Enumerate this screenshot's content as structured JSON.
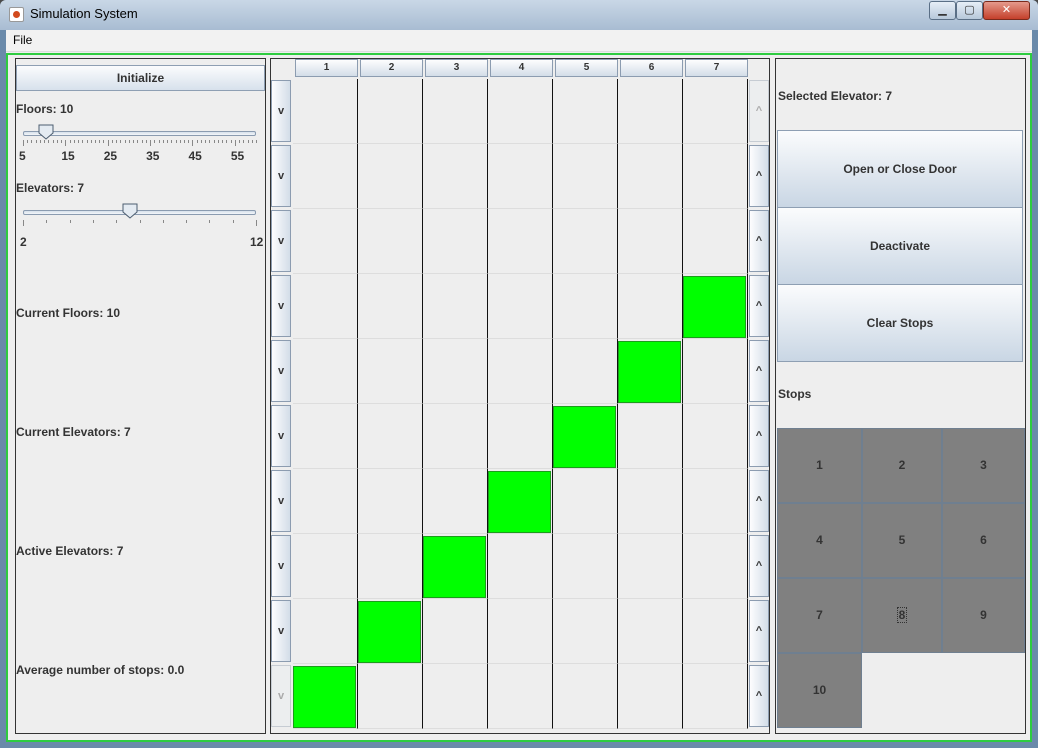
{
  "window": {
    "title": "Simulation System"
  },
  "menubar": {
    "file_label": "File"
  },
  "left": {
    "initialize_label": "Initialize",
    "floors_label": "Floors: 10",
    "floors_slider": {
      "min": 5,
      "max": 60,
      "value": 10,
      "tick_labels": [
        "5",
        "15",
        "25",
        "35",
        "45",
        "55"
      ]
    },
    "elevators_label": "Elevators: 7",
    "elevators_slider": {
      "min": 2,
      "max": 12,
      "value": 7,
      "tick_labels": [
        "2",
        "12"
      ]
    },
    "current_floors": "Current Floors: 10",
    "current_elevators": "Current Elevators: 7",
    "active_elevators": "Active Elevators: 7",
    "avg_stops": "Average number of stops: 0.0"
  },
  "shaft": {
    "columns": [
      "1",
      "2",
      "3",
      "4",
      "5",
      "6",
      "7"
    ],
    "floors": 10,
    "down_label": "v",
    "up_label": "^",
    "car_floors": [
      1,
      2,
      3,
      4,
      5,
      6,
      7
    ]
  },
  "right": {
    "selected_label": "Selected Elevator: 7",
    "open_close_label": "Open or Close Door",
    "deactivate_label": "Deactivate",
    "clear_stops_label": "Clear Stops",
    "stops_label": "Stops",
    "stops": [
      "1",
      "2",
      "3",
      "4",
      "5",
      "6",
      "7",
      "8",
      "9",
      "10"
    ],
    "focused_stop": "8"
  },
  "colors": {
    "car": "#00ff00",
    "frame": "#2ecc40",
    "stop_bg": "#808080"
  }
}
